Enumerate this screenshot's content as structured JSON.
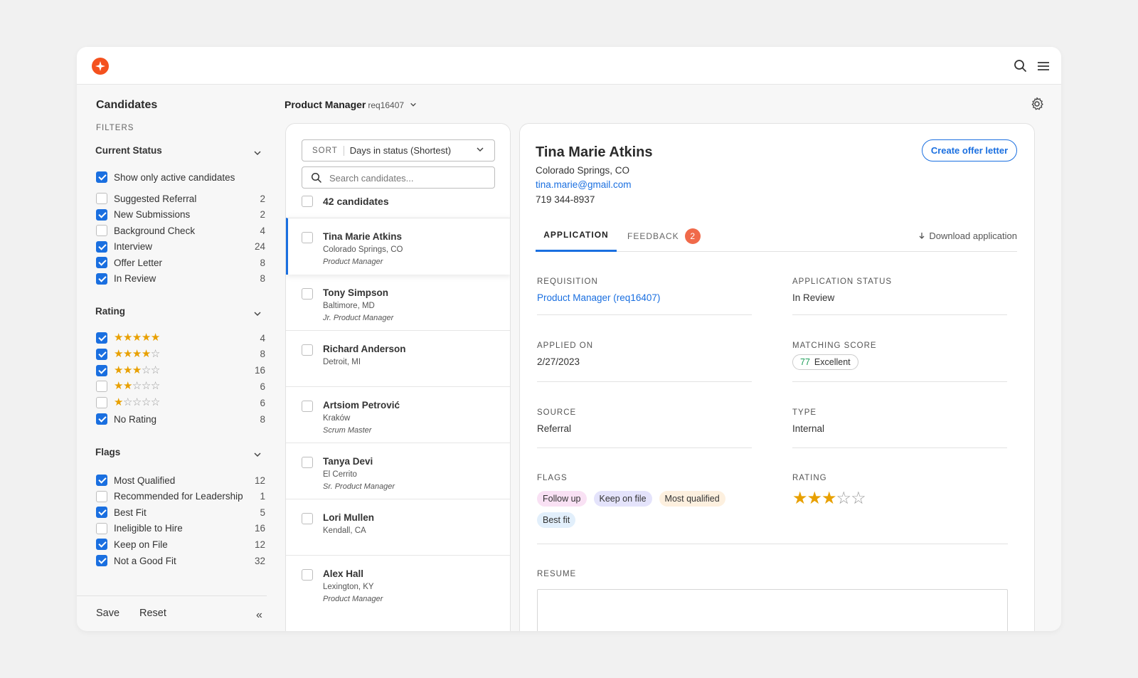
{
  "sidebar": {
    "title": "Candidates",
    "filters_label": "FILTERS",
    "status": {
      "title": "Current Status",
      "active_only": {
        "label": "Show only active candidates",
        "checked": true
      },
      "items": [
        {
          "label": "Suggested Referral",
          "count": "2",
          "checked": false
        },
        {
          "label": "New Submissions",
          "count": "2",
          "checked": true
        },
        {
          "label": "Background Check",
          "count": "4",
          "checked": false
        },
        {
          "label": "Interview",
          "count": "24",
          "checked": true
        },
        {
          "label": "Offer Letter",
          "count": "8",
          "checked": true
        },
        {
          "label": "In Review",
          "count": "8",
          "checked": true
        }
      ]
    },
    "rating": {
      "title": "Rating",
      "items": [
        {
          "stars": 5,
          "count": "4",
          "checked": true
        },
        {
          "stars": 4,
          "count": "8",
          "checked": true
        },
        {
          "stars": 3,
          "count": "16",
          "checked": true
        },
        {
          "stars": 2,
          "count": "6",
          "checked": false
        },
        {
          "stars": 1,
          "count": "6",
          "checked": false
        }
      ],
      "no_rating": {
        "label": "No Rating",
        "count": "8",
        "checked": true
      }
    },
    "flags": {
      "title": "Flags",
      "items": [
        {
          "label": "Most Qualified",
          "count": "12",
          "checked": true
        },
        {
          "label": "Recommended for Leadership",
          "count": "1",
          "checked": false
        },
        {
          "label": "Best Fit",
          "count": "5",
          "checked": true
        },
        {
          "label": "Ineligible to Hire",
          "count": "16",
          "checked": false
        },
        {
          "label": "Keep on File",
          "count": "12",
          "checked": true
        },
        {
          "label": "Not a Good Fit",
          "count": "32",
          "checked": true
        }
      ]
    },
    "footer": {
      "save": "Save",
      "reset": "Reset"
    }
  },
  "header": {
    "job_title": "Product Manager",
    "req": "req16407"
  },
  "list": {
    "sort_key": "SORT",
    "sort_value": "Days in status (Shortest)",
    "search_placeholder": "Search candidates...",
    "count_label": "42 candidates",
    "candidates": [
      {
        "name": "Tina Marie Atkins",
        "location": "Colorado Springs, CO",
        "role": "Product Manager",
        "selected": true
      },
      {
        "name": "Tony Simpson",
        "location": "Baltimore, MD",
        "role": "Jr. Product Manager"
      },
      {
        "name": "Richard Anderson",
        "location": "Detroit, MI",
        "role": ""
      },
      {
        "name": "Artsiom Petrović",
        "location": "Kraków",
        "role": "Scrum Master"
      },
      {
        "name": "Tanya Devi",
        "location": "El Cerrito",
        "role": "Sr. Product Manager"
      },
      {
        "name": "Lori Mullen",
        "location": "Kendall, CA",
        "role": ""
      },
      {
        "name": "Alex Hall",
        "location": "Lexington, KY",
        "role": "Product Manager"
      }
    ]
  },
  "detail": {
    "name": "Tina Marie Atkins",
    "location": "Colorado Springs, CO",
    "email": "tina.marie@gmail.com",
    "phone": "719 344-8937",
    "offer_button": "Create offer letter",
    "tabs": {
      "application": "APPLICATION",
      "feedback": "FEEDBACK",
      "feedback_count": "2"
    },
    "download": "Download application",
    "requisition": {
      "label": "REQUISITION",
      "value": "Product Manager (req16407)"
    },
    "app_status": {
      "label": "APPLICATION STATUS",
      "value": "In Review"
    },
    "applied_on": {
      "label": "APPLIED ON",
      "value": "2/27/2023"
    },
    "matching": {
      "label": "MATCHING SCORE",
      "score": "77",
      "text": "Excellent"
    },
    "source": {
      "label": "SOURCE",
      "value": "Referral"
    },
    "type": {
      "label": "TYPE",
      "value": "Internal"
    },
    "flags": {
      "label": "FLAGS",
      "items": [
        {
          "label": "Follow up",
          "color": "#f9e1f4"
        },
        {
          "label": "Keep on file",
          "color": "#e4e3fb"
        },
        {
          "label": "Most qualified",
          "color": "#fdf0df"
        },
        {
          "label": "Best fit",
          "color": "#e2effb"
        }
      ]
    },
    "rating": {
      "label": "RATING",
      "stars": 3,
      "max": 5
    },
    "resume_label": "RESUME"
  },
  "colors": {
    "accent": "#1a6fe0",
    "brand": "#f4511e",
    "star": "#e8a000"
  }
}
